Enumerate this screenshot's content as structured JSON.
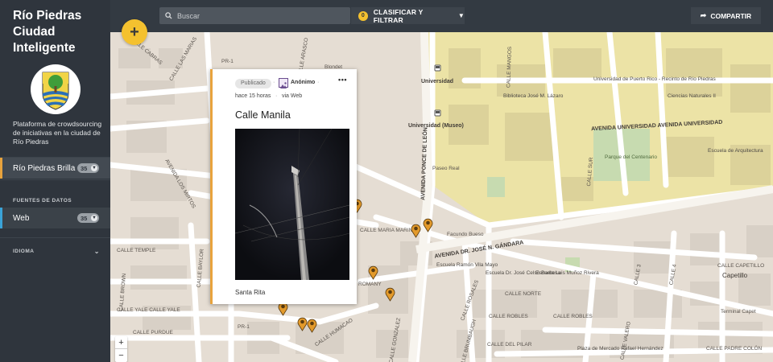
{
  "app": {
    "title": "Río Piedras Ciudad Inteligente",
    "description": "Plataforma de crowdsourcing de iniciativas en la ciudad de Río Piedras"
  },
  "sidebar": {
    "project_item": {
      "label": "Río Piedras Brilla",
      "count": "35"
    },
    "data_sources_heading": "FUENTES DE DATOS",
    "data_sources": [
      {
        "label": "Web",
        "count": "35"
      }
    ],
    "language_heading": "IDIOMA"
  },
  "toolbar": {
    "search_placeholder": "Buscar",
    "filter_count": "0",
    "filter_label": "CLASIFICAR Y FILTRAR",
    "share_label": "COMPARTIR",
    "add_label": "+",
    "zoom_in": "+",
    "zoom_out": "−"
  },
  "card": {
    "status": "Publicado",
    "author": "Anónimo",
    "time": "hace 15 horas",
    "source": "via Web",
    "title": "Calle Manila",
    "location": "Santa Rita",
    "accent_color": "#e8a33d"
  },
  "map": {
    "labels": {
      "pr1_top": "PR-1",
      "pr1_bottom": "PR-1",
      "calle_cabras": "CALLE CABRAS",
      "calle_las_marias": "CALLE LAS MARIAS",
      "calle_arasco": "CALLE ARASCO",
      "blondet": "Blondet",
      "universidad": "Universidad",
      "universidad_museo": "Universidad (Museo)",
      "biblioteca": "Biblioteca José M. Lázaro",
      "calle_mangos": "CALLE MANGOS",
      "upr": "Universidad de Puerto Rico - Recinto de Río Piedras",
      "ciencias": "Ciencias Naturales II",
      "av_universidad": "AVENIDA UNIVERSIDAD AVENIDA UNIVERSIDAD",
      "escuela_arq": "Escuela de Arquitectura",
      "parque": "Parque del Centenario",
      "calle_sur": "CALLE SUR",
      "paseo_real": "Paseo Real",
      "av_ponce": "AVENIDA PONCE DE LEÓN",
      "avenida_los_mirtos": "AVENIDA LOS MIRTOS",
      "facundo": "Facundo Bueso",
      "calle_maria": "CALLE MARIA MARIN",
      "av_gandara": "AVENIDA DR. JOSÉ N. GÁNDARA",
      "escuela_ramon": "Escuela Ramón Vila Mayo",
      "escuela_celso": "Escuela Dr. José Celso Barbosa",
      "escuela_luis": "Escuela Luis Muñoz Rivera",
      "calle_temple": "CALLE TEMPLE",
      "calle_baylor": "CALLE BAYLOR",
      "calle_brown": "CALLE BROWN",
      "calle_yale": "CALLE YALE CALLE YALE",
      "calle_purdue": "CALLE PURDUE",
      "calle_romany": "ROMANY",
      "calle_rosales": "CALLE ROSALES",
      "calle_norte": "CALLE NORTE",
      "calle_robles": "CALLE ROBLES",
      "calle_robles2": "CALLE ROBLES",
      "calle_del_pilar": "CALLE DEL PILAR",
      "calle_gonzalez": "CALLE GONZALEZ",
      "calle_brumbaugh": "CALLE BRUMBAUGH",
      "calle_humacao": "CALLE HUMACAO",
      "calle_capetillo": "CALLE CAPETILLO",
      "capetillo": "Capetillo",
      "terminal": "Terminal Capet",
      "plaza": "Plaza de Mercado Rafael Hernández",
      "calle_padre_colon": "CALLE PADRE COLÓN",
      "calle_3": "CALLE 3",
      "calle_4": "CALLE 4",
      "calle_valero": "CALLE VALERO"
    }
  },
  "colors": {
    "sidebar_bg": "#2f353d",
    "accent_yellow": "#f4c12f",
    "pin_orange": "#e39a2b",
    "campus_yellow": "#ece3a6",
    "park_green": "#c7dbb0"
  }
}
